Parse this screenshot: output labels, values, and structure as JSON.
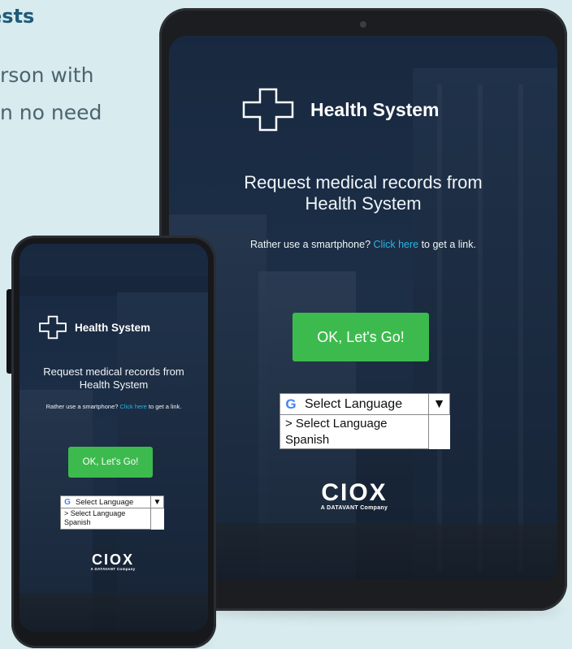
{
  "background_text": {
    "heading_fragment": "ests",
    "line1_fragment": "rson with",
    "line2_fragment": "n no need"
  },
  "tablet": {
    "brand": "Health System",
    "headline_line1": "Request medical records from",
    "headline_line2": "Health System",
    "smartphone_prefix": "Rather use a smartphone? ",
    "smartphone_link": "Click here",
    "smartphone_suffix": " to get a link.",
    "cta_label": "OK, Let's Go!",
    "language_selected": "Select Language",
    "language_options": [
      "> Select Language",
      "Spanish"
    ],
    "ciox_word": "CIOX",
    "ciox_sub": "A DATAVANT Company"
  },
  "phone": {
    "brand": "Health System",
    "headline_line1": "Request medical records from",
    "headline_line2": "Health System",
    "smartphone_prefix": "Rather use a smartphone? ",
    "smartphone_link": "Click here",
    "smartphone_suffix": " to get a link.",
    "cta_label": "OK, Let's Go!",
    "language_selected": "Select Language",
    "language_options": [
      "> Select Language",
      "Spanish"
    ],
    "ciox_word": "CIOX",
    "ciox_sub": "A DATAVANT Company"
  },
  "colors": {
    "cta_green": "#3dba4e",
    "link_blue": "#28b4e4",
    "heading_blue": "#1f5a7a",
    "page_bg": "#d8ebee"
  },
  "icons": {
    "logo": "medical-cross-outline-icon",
    "google": "google-g-icon",
    "dropdown": "triangle-down-icon"
  }
}
